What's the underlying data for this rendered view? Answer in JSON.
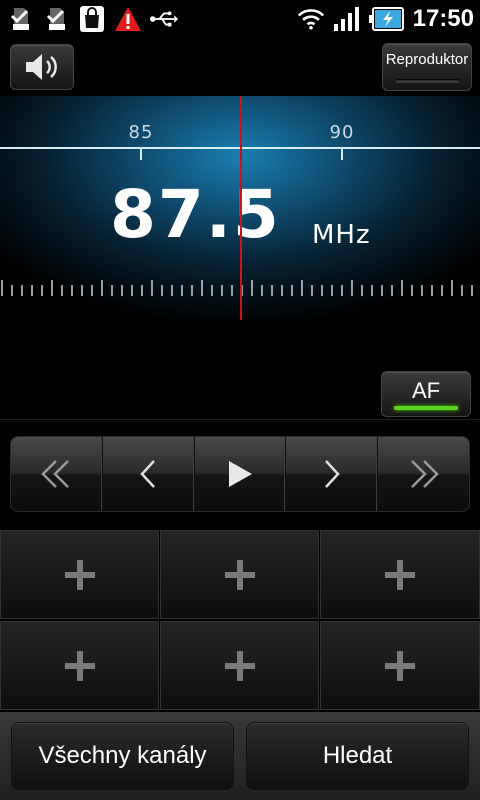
{
  "status_bar": {
    "icons": [
      "sd-card-check-icon",
      "sd-card-check-icon",
      "store-bag-icon",
      "warning-icon",
      "usb-icon"
    ],
    "right_icons": [
      "wifi-icon",
      "signal-icon",
      "battery-charging-icon"
    ],
    "time": "17:50"
  },
  "top": {
    "speaker_icon": "speaker-icon",
    "output_button": "Reproduktor"
  },
  "tuner": {
    "scale_labels": [
      "85",
      "90"
    ],
    "frequency": "87.5",
    "unit": "MHz"
  },
  "af": {
    "label": "AF",
    "active_color": "#58d41c"
  },
  "transport": {
    "buttons": [
      "seek-back-icon",
      "step-back-icon",
      "play-icon",
      "step-forward-icon",
      "seek-forward-icon"
    ]
  },
  "presets": {
    "empty_icon": "plus-icon",
    "count": 6
  },
  "bottom": {
    "all_channels": "Všechny kanály",
    "search": "Hledat"
  },
  "colors": {
    "needle": "#c8141a",
    "tuner_glow": "#1a7fb0"
  }
}
